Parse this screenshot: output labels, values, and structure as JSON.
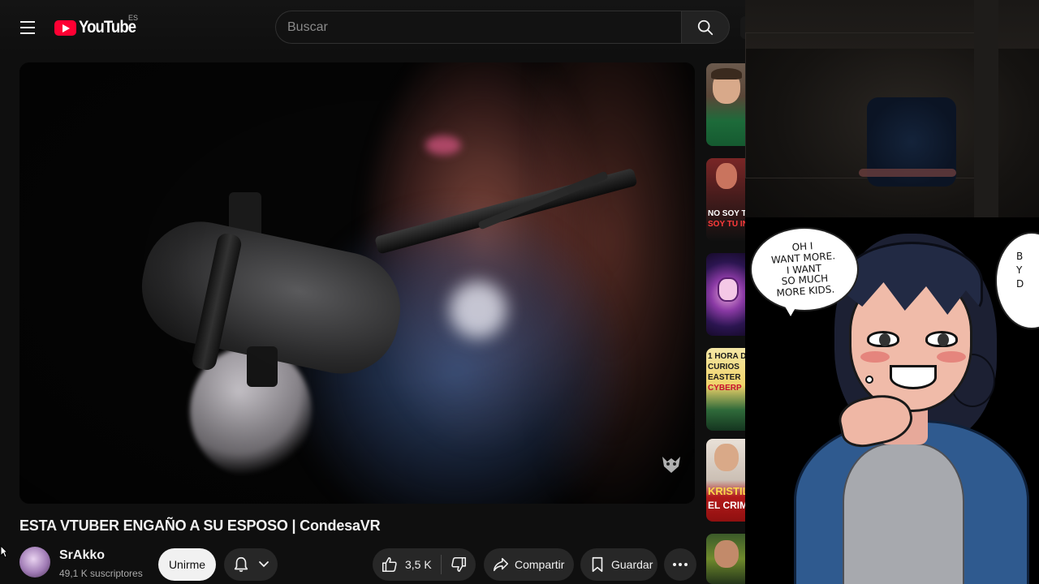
{
  "header": {
    "logo_text": "YouTube",
    "country_code": "ES",
    "search_placeholder": "Buscar"
  },
  "video": {
    "title": "ESTA VTUBER ENGAÑO A SU ESPOSO | CondesaVR"
  },
  "channel": {
    "name": "SrAkko",
    "subscribers": "49,1 K suscriptores",
    "join_label": "Unirme"
  },
  "actions": {
    "like_count": "3,5 K",
    "share_label": "Compartir",
    "save_label": "Guardar"
  },
  "sidebar": {
    "thumbs": [
      {
        "caption": ""
      },
      {
        "caption_line1": "NO SOY TU",
        "caption_line2": "SOY TU IN"
      },
      {
        "caption": ""
      },
      {
        "caption_line1": "1 HORA D",
        "caption_line2": "CURIOS",
        "caption_line3": "EASTER",
        "caption_line4": "CYBERP"
      },
      {
        "caption_line1": "KRISTIL",
        "caption_line2": "EL CRIME"
      },
      {
        "caption": ""
      }
    ]
  },
  "overlay": {
    "bubble_text_lines": [
      "OH I",
      "WANT MORE.",
      "I WANT",
      "SO MUCH",
      "MORE KIDS."
    ],
    "bubble2_text_lines": [
      "B",
      "Y",
      "D"
    ]
  },
  "colors": {
    "accent": "#ff0033",
    "background": "#0f0f0f",
    "button_bg": "#272727",
    "join_bg": "#f1f1f1"
  }
}
